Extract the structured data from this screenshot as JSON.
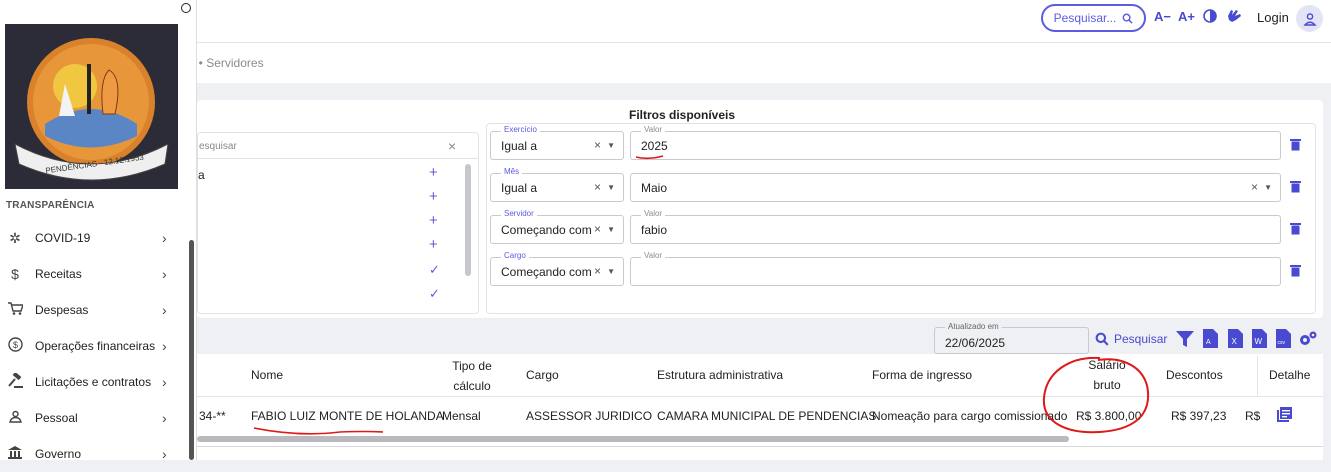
{
  "topbar": {
    "search_label": "Pesquisar...",
    "font_decrease": "A−",
    "font_increase": "A+",
    "login_label": "Login"
  },
  "breadcrumb": {
    "text": "al • Servidores"
  },
  "sidebar": {
    "logo_text": "PENDÊNCIAS - 12.12.1953",
    "section_label": "TRANSPARÊNCIA",
    "items": [
      {
        "label": "COVID-19",
        "icon": "virus-icon"
      },
      {
        "label": "Receitas",
        "icon": "dollar-icon"
      },
      {
        "label": "Despesas",
        "icon": "cart-icon"
      },
      {
        "label": "Operações financeiras",
        "icon": "coin-icon"
      },
      {
        "label": "Licitações e contratos",
        "icon": "gavel-icon"
      },
      {
        "label": "Pessoal",
        "icon": "person-icon"
      },
      {
        "label": "Governo",
        "icon": "building-icon"
      }
    ]
  },
  "filters": {
    "title": "Filtros disponíveis",
    "left_search_placeholder": "esquisar",
    "left_item_text": "a",
    "rows": [
      {
        "field_label": "Exercício",
        "operator": "Igual a",
        "value_label": "Valor",
        "value": "2025"
      },
      {
        "field_label": "Mês",
        "operator": "Igual a",
        "value_label": "",
        "value": "Maio"
      },
      {
        "field_label": "Servidor",
        "operator": "Começando com",
        "value_label": "Valor",
        "value": "fabio"
      },
      {
        "field_label": "Cargo",
        "operator": "Começando com",
        "value_label": "Valor",
        "value": ""
      }
    ]
  },
  "toolbar": {
    "updated_label": "Atualizado em",
    "updated_value": "22/06/2025",
    "search_label": "Pesquisar"
  },
  "table": {
    "headers": {
      "nome": "Nome",
      "tipo_1": "Tipo de",
      "tipo_2": "cálculo",
      "cargo": "Cargo",
      "estrutura": "Estrutura administrativa",
      "forma": "Forma de ingresso",
      "salario_1": "Salário",
      "salario_2": "bruto",
      "descontos": "Descontos",
      "detalhe": "Detalhe"
    },
    "row": {
      "cpf": "34-**",
      "nome": "FABIO LUIZ MONTE DE HOLANDA",
      "tipo": "Mensal",
      "cargo": "ASSESSOR JURIDICO",
      "estrutura": "CAMARA MUNICIPAL DE PENDENCIAS",
      "forma": "Nomeação para cargo comissionado",
      "salario": "R$ 3.800,00",
      "descontos": "R$ 397,23",
      "liquido": "R$"
    }
  }
}
